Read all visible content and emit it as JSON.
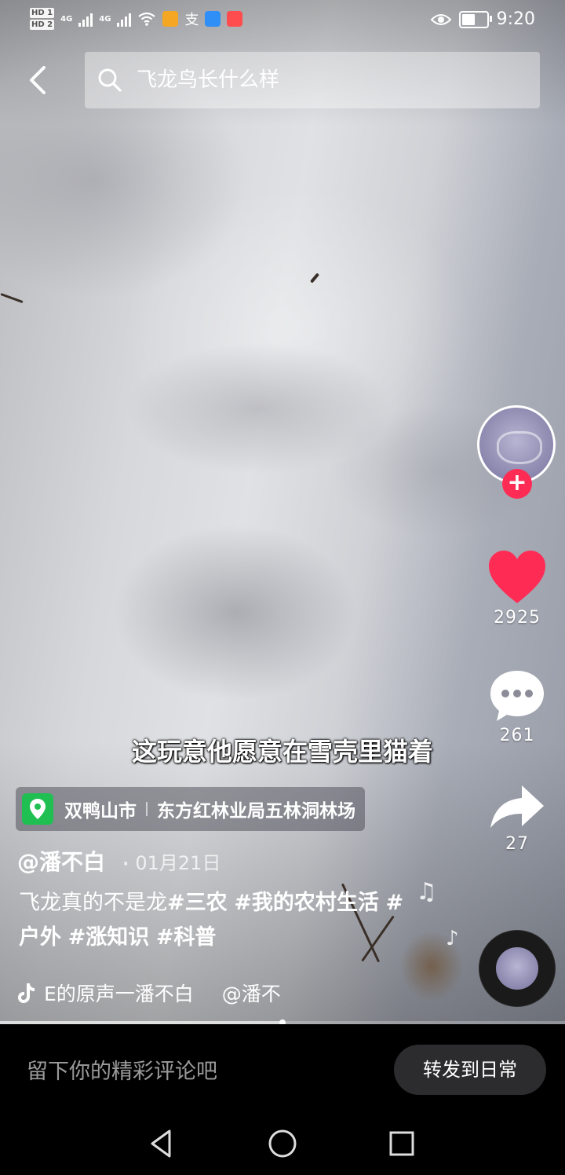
{
  "status_bar": {
    "hd1": "HD 1",
    "hd2": "HD 2",
    "network1": "4G",
    "network2": "4G",
    "time": "9:20",
    "battery_level_percent": 55
  },
  "search": {
    "query": "飞龙鸟长什么样"
  },
  "video": {
    "subtitle": "这玩意他愿意在雪壳里猫着",
    "progress_percent": 50
  },
  "actions": {
    "likes": "2925",
    "comments": "261",
    "shares": "27",
    "like_color": "#fe2c55",
    "follow_color": "#fe2c55"
  },
  "location": {
    "city": "双鸭山市",
    "place": "东方红林业局五林洞林场",
    "pin_color": "#1fbf52"
  },
  "post": {
    "author": "@潘不白",
    "date": "01月21日",
    "text": "飞龙真的不是龙",
    "tags": [
      "#三农",
      "#我的农村生活",
      "#户外",
      "#涨知识",
      "#科普"
    ]
  },
  "music": {
    "title": "E的原声一潘不白",
    "artist": "@潘不"
  },
  "comment_bar": {
    "placeholder": "留下你的精彩评论吧",
    "repost_label": "转发到日常"
  }
}
